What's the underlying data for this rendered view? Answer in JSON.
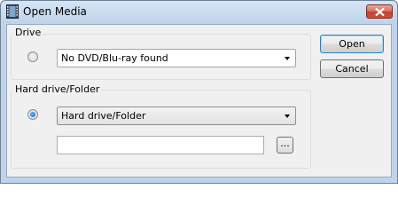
{
  "window": {
    "title": "Open Media",
    "icon": "film-icon"
  },
  "drive": {
    "group_label": "Drive",
    "combo_value": "No DVD/Blu-ray found"
  },
  "hard_drive": {
    "group_label": "Hard drive/Folder",
    "combo_value": "Hard drive/Folder",
    "path_value": "",
    "browse_label": "..."
  },
  "buttons": {
    "open_label": "Open",
    "cancel_label": "Cancel"
  }
}
